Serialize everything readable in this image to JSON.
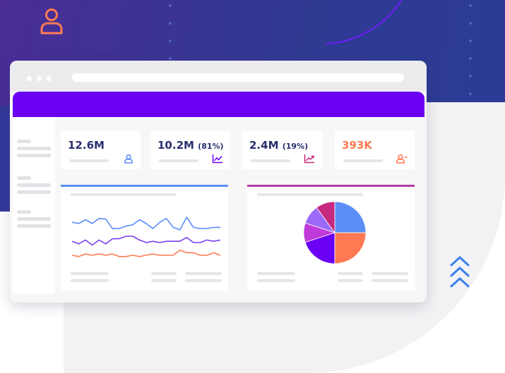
{
  "colors": {
    "header_gradient_start": "#4a2d97",
    "header_gradient_end": "#2c3c96",
    "banner": "#6a00f4",
    "blue": "#5b8ef5",
    "purple": "#7a3ff0",
    "orange": "#ff7a52",
    "magenta": "#b03da8",
    "navy_text": "#2a2f6e"
  },
  "decor": {
    "top_icon": "person-outline-icon",
    "corner_icon": "double-chevron-up-icon"
  },
  "stats": [
    {
      "value": "12.6M",
      "pct": "",
      "icon": "user-icon"
    },
    {
      "value": "10.2M",
      "pct": "(81%)",
      "icon": "line-chart-icon"
    },
    {
      "value": "2.4M",
      "pct": "(19%)",
      "icon": "trend-up-icon"
    },
    {
      "value": "393K",
      "pct": "",
      "icon": "user-minus-icon"
    }
  ],
  "line_panel": {
    "icon": "line-chart-icon",
    "chart_data": {
      "type": "line",
      "x": [
        1,
        2,
        3,
        4,
        5,
        6,
        7,
        8,
        9,
        10,
        11,
        12,
        13,
        14,
        15,
        16,
        17,
        18,
        19,
        20,
        21,
        22,
        23
      ],
      "series": [
        {
          "color": "#5b8ef5",
          "values": [
            72,
            70,
            76,
            70,
            78,
            77,
            62,
            62,
            66,
            68,
            76,
            70,
            62,
            72,
            78,
            64,
            60,
            80,
            64,
            62,
            62,
            64,
            64
          ]
        },
        {
          "color": "#7a3ff0",
          "values": [
            42,
            38,
            44,
            36,
            44,
            38,
            46,
            46,
            50,
            50,
            44,
            40,
            42,
            40,
            42,
            42,
            42,
            48,
            40,
            40,
            44,
            42,
            44
          ]
        },
        {
          "color": "#ff7a52",
          "values": [
            20,
            18,
            22,
            20,
            22,
            20,
            22,
            18,
            18,
            20,
            18,
            20,
            22,
            20,
            20,
            20,
            28,
            24,
            24,
            20,
            20,
            24,
            20
          ]
        }
      ]
    }
  },
  "pie_panel": {
    "chart_data": {
      "type": "pie",
      "slices": [
        {
          "color": "#5b8ef5",
          "value": 25
        },
        {
          "color": "#ff7a52",
          "value": 25
        },
        {
          "color": "#6a00f4",
          "value": 20
        },
        {
          "color": "#c03ad9",
          "value": 10
        },
        {
          "color": "#9b6bf7",
          "value": 10
        },
        {
          "color": "#c6297f",
          "value": 10
        }
      ]
    }
  }
}
